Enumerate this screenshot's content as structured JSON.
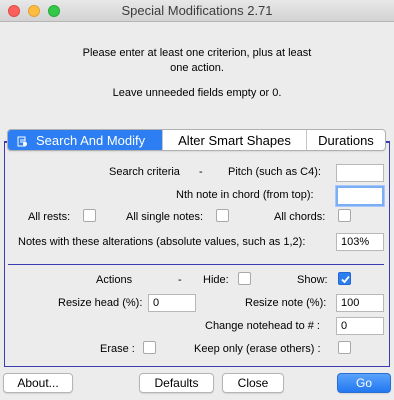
{
  "window": {
    "title": "Special Modifications 2.71"
  },
  "intro": {
    "line1": "Please enter at least one criterion, plus at least",
    "line2": "one action.",
    "line3": "Leave unneeded fields empty or 0."
  },
  "tabs": [
    {
      "label": "Search And Modify",
      "active": true
    },
    {
      "label": "Alter Smart Shapes",
      "active": false
    },
    {
      "label": "Durations",
      "active": false
    }
  ],
  "criteria": {
    "section_label": "Search criteria",
    "dash": "-",
    "pitch_label": "Pitch (such as C4):",
    "pitch_value": "",
    "nth_note_label": "Nth note in chord (from top):",
    "nth_note_value": "",
    "all_rests_label": "All rests:",
    "all_rests_checked": false,
    "all_single_label": "All single notes:",
    "all_single_checked": false,
    "all_chords_label": "All chords:",
    "all_chords_checked": false,
    "alterations_label": "Notes with these alterations (absolute values, such as 1,2):",
    "alterations_value": "103%"
  },
  "actions": {
    "section_label": "Actions",
    "dash": "-",
    "hide_label": "Hide:",
    "hide_checked": false,
    "show_label": "Show:",
    "show_checked": true,
    "resize_head_label": "Resize head (%):",
    "resize_head_value": "0",
    "resize_note_label": "Resize note (%):",
    "resize_note_value": "100",
    "notehead_label": "Change notehead to # :",
    "notehead_value": "0",
    "erase_label": "Erase :",
    "erase_checked": false,
    "keep_only_label": "Keep only (erase others) :",
    "keep_only_checked": false
  },
  "buttons": {
    "about": "About...",
    "defaults": "Defaults",
    "close": "Close",
    "go": "Go"
  },
  "colors": {
    "accent": "#2c7ef2",
    "panel_border": "#3c3cb0"
  }
}
